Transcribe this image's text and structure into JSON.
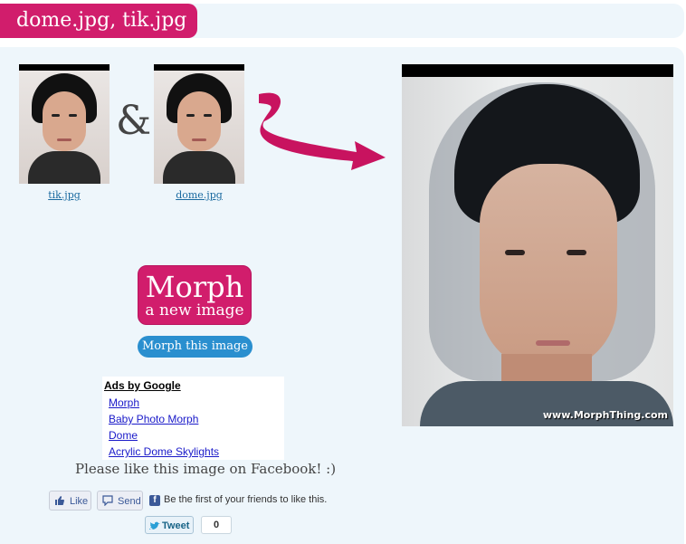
{
  "header": {
    "title": "dome.jpg, tik.jpg"
  },
  "sources": [
    {
      "link_text": "tik.jpg"
    },
    {
      "link_text": "dome.jpg"
    }
  ],
  "ampersand": "&",
  "result": {
    "watermark": "www.MorphThing.com"
  },
  "morph_button": {
    "line1": "Morph",
    "line2": "a new image"
  },
  "morph_this_label": "Morph this image",
  "ads": {
    "title": "Ads by Google",
    "links": [
      "Morph",
      "Baby Photo Morph",
      "Dome",
      "Acrylic Dome Skylights"
    ]
  },
  "facebook": {
    "prompt": "Please like this image on Facebook! :)",
    "like_label": "Like",
    "send_label": "Send",
    "social_text": "Be the first of your friends to like this."
  },
  "twitter": {
    "tweet_label": "Tweet",
    "count": "0"
  },
  "colors": {
    "brand_pink": "#d11d6c",
    "panel_bg": "#eef6fb",
    "button_blue": "#2a8fcf"
  }
}
